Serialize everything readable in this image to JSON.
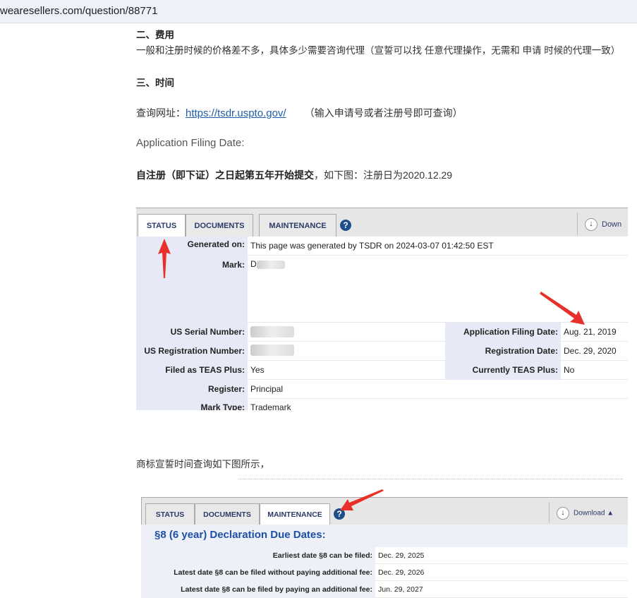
{
  "browser": {
    "url": "wearesellers.com/question/88771"
  },
  "article": {
    "section2_heading": "二、费用",
    "section2_text": "一般和注册时候的价格差不多，具体多少需要咨询代理（宣誓可以找 任意代理操作，无需和 申请 时候的代理一致）",
    "section3_heading": "三、时间",
    "query_label": "查询网址：",
    "query_link": "https://tsdr.uspto.gov/",
    "query_note": "（输入申请号或者注册号即可查询）",
    "filing_date_label": "Application Filing Date:",
    "rule_bold": "自注册（即下证）之日起第五年开始提交",
    "rule_rest": "，如下图：注册日为2020.12.29",
    "caption2": "商标宣誓时间查询如下图所示，"
  },
  "tsdr1": {
    "tabs": [
      "STATUS",
      "DOCUMENTS",
      "MAINTENANCE"
    ],
    "active_tab": "STATUS",
    "help": "?",
    "download": "Down",
    "generated_label": "Generated on:",
    "generated_value": "This page was generated by TSDR on 2024-03-07 01:42:50 EST",
    "mark_label": "Mark:",
    "mark_value": "D",
    "serial_label": "US Serial Number:",
    "reg_number_label": "US Registration Number:",
    "teas_label": "Filed as TEAS Plus:",
    "teas_value": "Yes",
    "register_label": "Register:",
    "register_value": "Principal",
    "mark_type_label": "Mark Type:",
    "mark_type_value": "Trademark",
    "filing_label": "Application Filing Date:",
    "filing_value": "Aug. 21, 2019",
    "reg_date_label": "Registration Date:",
    "reg_date_value": "Dec. 29, 2020",
    "current_teas_label": "Currently TEAS Plus:",
    "current_teas_value": "No"
  },
  "tsdr2": {
    "tabs": [
      "STATUS",
      "DOCUMENTS",
      "MAINTENANCE"
    ],
    "active_tab": "MAINTENANCE",
    "help": "?",
    "download": "Download ▲",
    "heading": "§8 (6 year) Declaration Due Dates:",
    "rows": [
      {
        "label": "Earliest date §8 can be filed:",
        "value": "Dec. 29, 2025"
      },
      {
        "label": "Latest date §8 can be filed without paying additional fee:",
        "value": "Dec. 29, 2026"
      },
      {
        "label": "Latest date §8 can be filed by paying an additional fee:",
        "value": "Jun. 29, 2027"
      }
    ]
  },
  "colors": {
    "arrow": "#e8302a",
    "label_bg": "#e7e9f6",
    "heading_blue": "#1d4fa6"
  }
}
